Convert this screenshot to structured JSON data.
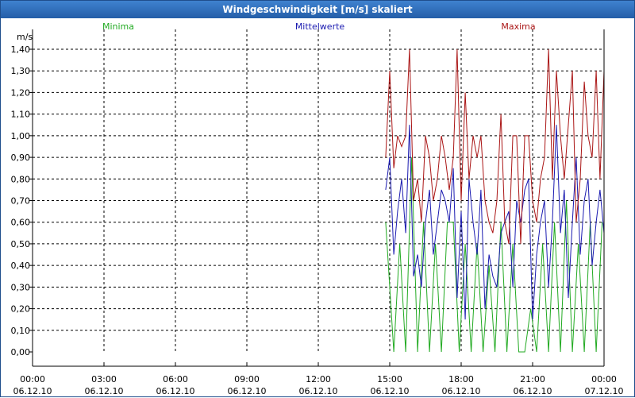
{
  "window": {
    "title": "Windgeschwindigkeit [m/s] skaliert"
  },
  "colors": {
    "min": "#22aa22",
    "mean": "#1a1ab0",
    "max": "#aa1515",
    "titlebar": "#2d6ab8"
  },
  "chart_data": {
    "type": "line",
    "title": "Windgeschwindigkeit [m/s] skaliert",
    "ylabel": "m/s",
    "ylim": [
      0,
      1.4
    ],
    "y_ticks": [
      "0,00",
      "0,10",
      "0,20",
      "0,30",
      "0,40",
      "0,50",
      "0,60",
      "0,70",
      "0,80",
      "0,90",
      "1,00",
      "1,10",
      "1,20",
      "1,30",
      "1,40"
    ],
    "xlim": [
      0,
      24
    ],
    "x_ticks": [
      {
        "time": "00:00",
        "date": "06.12.10"
      },
      {
        "time": "03:00",
        "date": "06.12.10"
      },
      {
        "time": "06:00",
        "date": "06.12.10"
      },
      {
        "time": "09:00",
        "date": "06.12.10"
      },
      {
        "time": "12:00",
        "date": "06.12.10"
      },
      {
        "time": "15:00",
        "date": "06.12.10"
      },
      {
        "time": "18:00",
        "date": "06.12.10"
      },
      {
        "time": "21:00",
        "date": "06.12.10"
      },
      {
        "time": "00:00",
        "date": "07.12.10"
      }
    ],
    "grid": true,
    "legend": "top",
    "series": [
      {
        "name": "Minima",
        "color": "#22aa22",
        "x": [
          14.83,
          15.17,
          15.42,
          15.67,
          15.92,
          16.17,
          16.42,
          16.67,
          16.92,
          17.17,
          17.42,
          17.67,
          17.92,
          18.17,
          18.42,
          18.67,
          18.92,
          19.17,
          19.42,
          19.67,
          19.92,
          20.17,
          20.42,
          20.67,
          20.92,
          21.17,
          21.42,
          21.67,
          21.92,
          22.17,
          22.42,
          22.67,
          22.92,
          23.17,
          23.42,
          23.67,
          23.92
        ],
        "y": [
          0.6,
          0.0,
          0.5,
          0.0,
          0.9,
          0.0,
          0.6,
          0.0,
          0.5,
          0.0,
          0.6,
          0.6,
          0.0,
          0.5,
          0.0,
          0.5,
          0.0,
          0.4,
          0.0,
          0.6,
          0.0,
          0.5,
          0.0,
          0.0,
          0.2,
          0.0,
          0.5,
          0.0,
          0.6,
          0.0,
          0.7,
          0.0,
          0.5,
          0.0,
          0.6,
          0.0,
          0.6
        ]
      },
      {
        "name": "Mittelwerte",
        "color": "#1a1ab0",
        "x": [
          14.83,
          15.0,
          15.17,
          15.33,
          15.5,
          15.67,
          15.83,
          16.0,
          16.17,
          16.33,
          16.5,
          16.67,
          16.83,
          17.0,
          17.17,
          17.33,
          17.5,
          17.67,
          17.83,
          18.0,
          18.17,
          18.33,
          18.5,
          18.67,
          18.83,
          19.0,
          19.17,
          19.33,
          19.5,
          19.67,
          19.83,
          20.0,
          20.17,
          20.33,
          20.5,
          20.67,
          20.83,
          21.0,
          21.17,
          21.33,
          21.5,
          21.67,
          21.83,
          22.0,
          22.17,
          22.33,
          22.5,
          22.67,
          22.83,
          23.0,
          23.17,
          23.33,
          23.5,
          23.67,
          23.83,
          24.0
        ],
        "y": [
          0.75,
          0.9,
          0.45,
          0.65,
          0.8,
          0.55,
          1.05,
          0.35,
          0.45,
          0.3,
          0.6,
          0.75,
          0.45,
          0.6,
          0.75,
          0.7,
          0.6,
          0.85,
          0.25,
          0.65,
          0.15,
          0.8,
          0.6,
          0.45,
          0.75,
          0.2,
          0.45,
          0.35,
          0.3,
          0.55,
          0.6,
          0.65,
          0.3,
          0.7,
          0.6,
          0.75,
          0.8,
          0.15,
          0.45,
          0.6,
          0.7,
          0.3,
          0.6,
          1.05,
          0.55,
          0.75,
          0.25,
          0.6,
          0.9,
          0.45,
          0.7,
          0.8,
          0.4,
          0.6,
          0.75,
          0.55
        ]
      },
      {
        "name": "Maxima",
        "color": "#aa1515",
        "x": [
          14.83,
          15.0,
          15.17,
          15.33,
          15.5,
          15.67,
          15.83,
          16.0,
          16.17,
          16.33,
          16.5,
          16.67,
          16.83,
          17.0,
          17.17,
          17.33,
          17.5,
          17.67,
          17.83,
          18.0,
          18.17,
          18.33,
          18.5,
          18.67,
          18.83,
          19.0,
          19.17,
          19.33,
          19.5,
          19.67,
          19.83,
          20.0,
          20.17,
          20.33,
          20.5,
          20.67,
          20.83,
          21.0,
          21.17,
          21.33,
          21.5,
          21.67,
          21.83,
          22.0,
          22.17,
          22.33,
          22.5,
          22.67,
          22.83,
          23.0,
          23.17,
          23.33,
          23.5,
          23.67,
          23.83,
          24.0
        ],
        "y": [
          0.9,
          1.3,
          0.85,
          1.0,
          0.95,
          1.0,
          1.4,
          0.7,
          0.8,
          0.6,
          1.0,
          0.9,
          0.7,
          0.8,
          1.0,
          0.9,
          0.75,
          0.9,
          1.4,
          0.7,
          1.2,
          0.8,
          1.0,
          0.9,
          1.0,
          0.7,
          0.6,
          0.55,
          0.7,
          1.1,
          0.6,
          0.5,
          1.0,
          1.0,
          0.5,
          1.0,
          1.0,
          0.7,
          0.6,
          0.8,
          0.9,
          1.4,
          0.8,
          1.3,
          1.0,
          0.8,
          1.05,
          1.3,
          0.6,
          0.8,
          1.25,
          1.0,
          0.9,
          1.3,
          0.8,
          1.3
        ]
      }
    ]
  }
}
